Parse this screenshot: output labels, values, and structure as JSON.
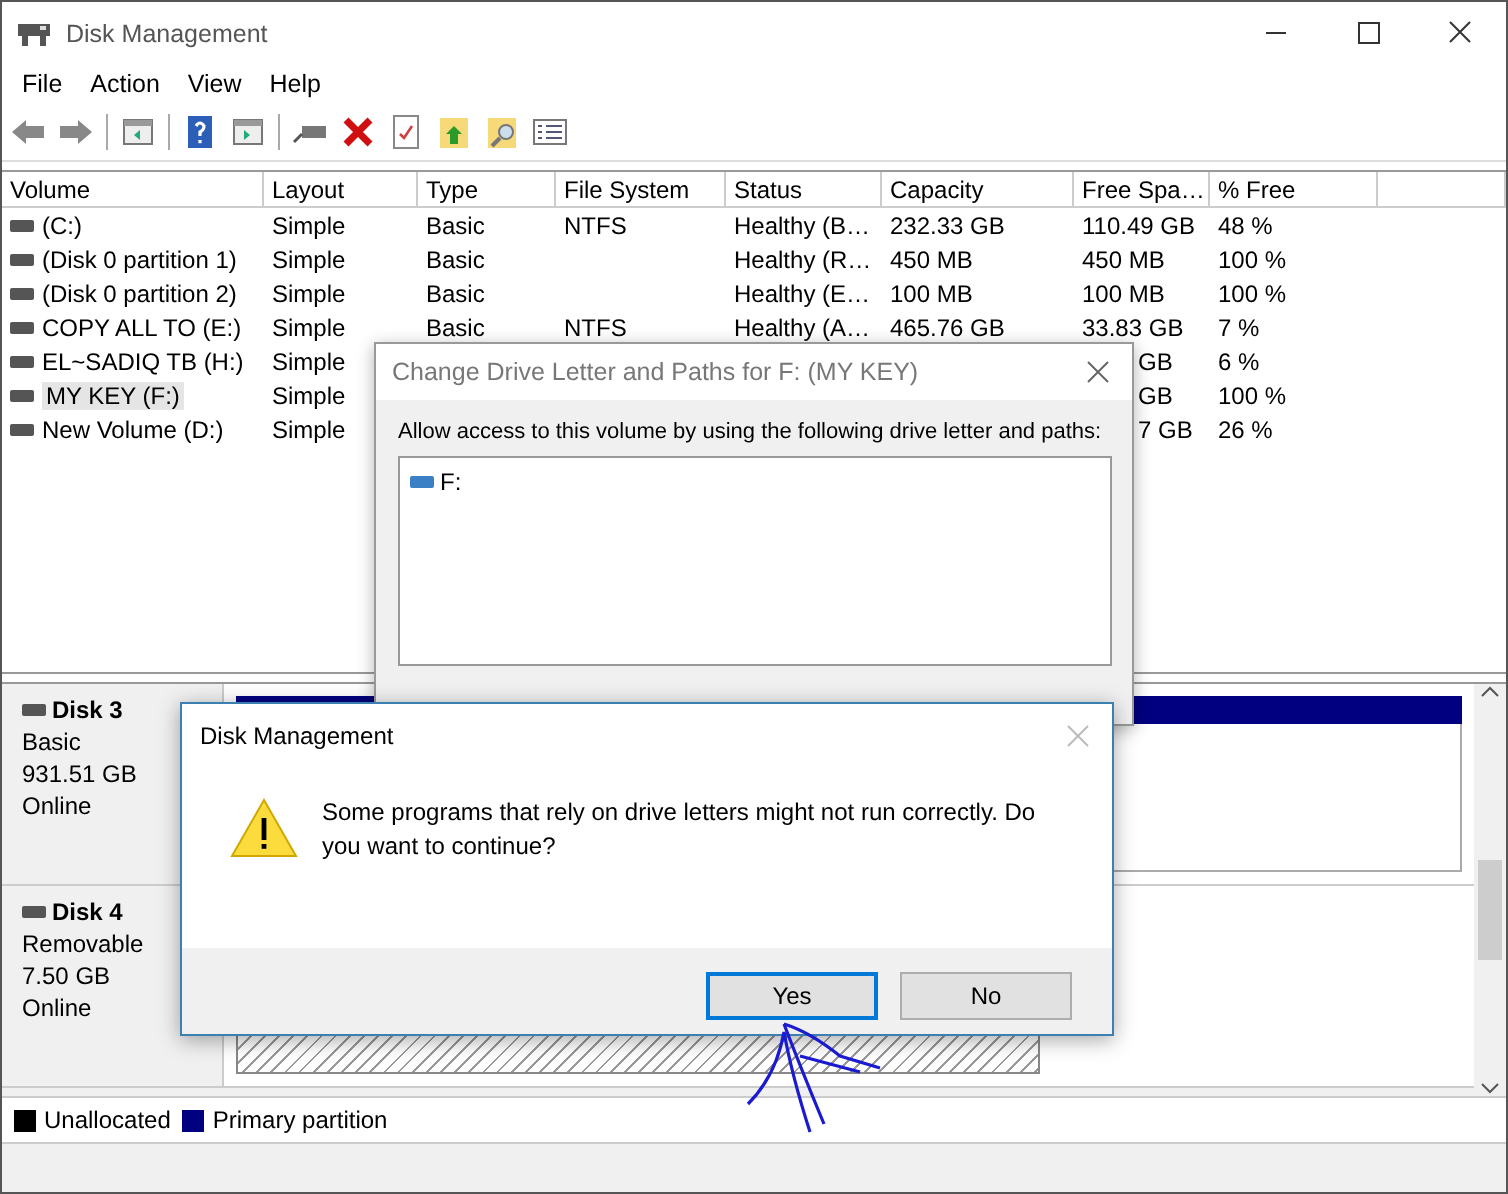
{
  "window": {
    "title": "Disk Management"
  },
  "menu": [
    "File",
    "Action",
    "View",
    "Help"
  ],
  "table": {
    "columns": [
      "Volume",
      "Layout",
      "Type",
      "File System",
      "Status",
      "Capacity",
      "Free Spa…",
      "% Free"
    ],
    "rows": [
      {
        "volume": "(C:)",
        "layout": "Simple",
        "type": "Basic",
        "file_system": "NTFS",
        "status": "Healthy (B…",
        "capacity": "232.33 GB",
        "free_space": "110.49 GB",
        "percent_free": "48 %",
        "selected": false,
        "covered": false
      },
      {
        "volume": "(Disk 0 partition 1)",
        "layout": "Simple",
        "type": "Basic",
        "status": "Healthy (R…",
        "capacity": "450 MB",
        "free_space": "450 MB",
        "percent_free": "100 %",
        "selected": false,
        "covered": false
      },
      {
        "volume": "(Disk 0 partition 2)",
        "layout": "Simple",
        "type": "Basic",
        "status": "Healthy (E…",
        "capacity": "100 MB",
        "free_space": "100 MB",
        "percent_free": "100 %",
        "selected": false,
        "covered": false
      },
      {
        "volume": "COPY ALL TO (E:)",
        "layout": "Simple",
        "type": "Basic",
        "file_system": "NTFS",
        "status": "Healthy (A…",
        "capacity": "465.76 GB",
        "free_space": "33.83 GB",
        "percent_free": "7 %",
        "selected": false,
        "covered": false
      },
      {
        "volume": "EL~SADIQ TB (H:)",
        "layout": "Simple",
        "free_space": "GB",
        "percent_free": "6 %",
        "selected": false,
        "covered": true
      },
      {
        "volume": "MY KEY (F:)",
        "layout": "Simple",
        "free_space": "GB",
        "percent_free": "100 %",
        "selected": true,
        "covered": true
      },
      {
        "volume": "New Volume (D:)",
        "layout": "Simple",
        "free_space": "7 GB",
        "percent_free": "26 %",
        "selected": false,
        "covered": true
      }
    ]
  },
  "disks": [
    {
      "name": "Disk 3",
      "type": "Basic",
      "size": "931.51 GB",
      "status": "Online"
    },
    {
      "name": "Disk 4",
      "type": "Removable",
      "size": "7.50 GB",
      "status": "Online"
    }
  ],
  "legend": [
    {
      "label": "Unallocated",
      "color": "#000000"
    },
    {
      "label": "Primary partition",
      "color": "#000080"
    }
  ],
  "drive_letter_dialog": {
    "title": "Change Drive Letter and Paths for F: (MY KEY)",
    "prompt": "Allow access to this volume by using the following drive letter and paths:",
    "paths": [
      "F:"
    ]
  },
  "confirm_dialog": {
    "title": "Disk Management",
    "message": "Some programs that rely on drive letters might not run correctly. Do you want to continue?",
    "buttons": [
      {
        "label": "Yes",
        "default": true
      },
      {
        "label": "No",
        "default": false
      }
    ]
  }
}
